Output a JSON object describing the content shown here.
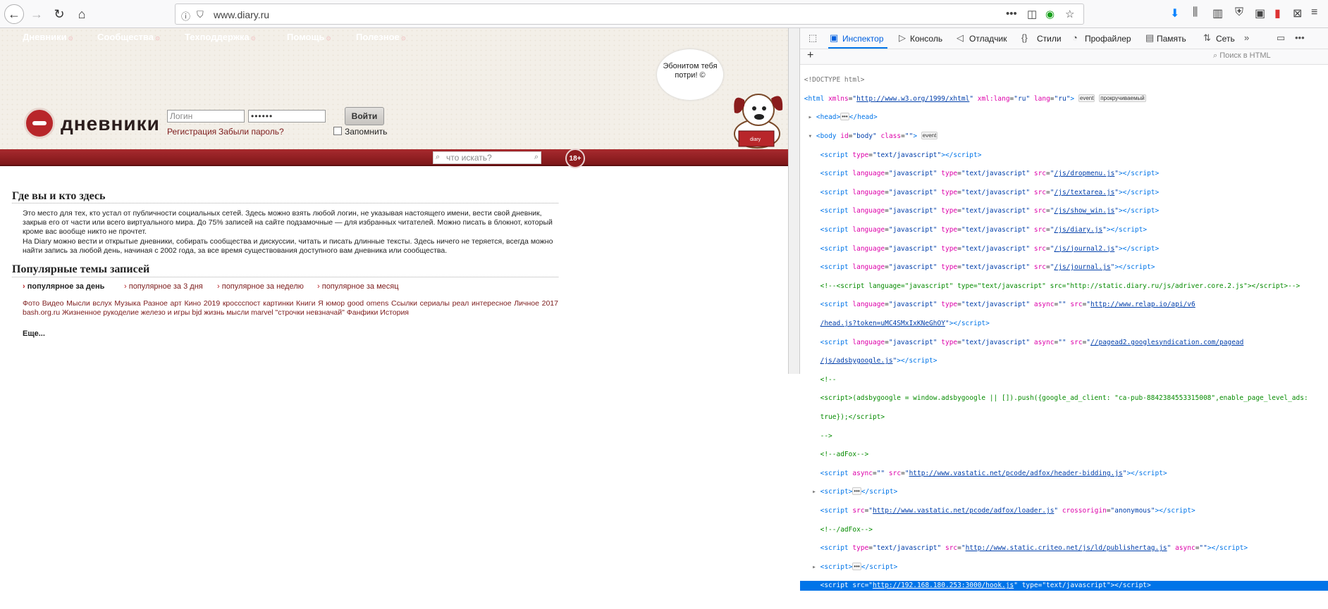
{
  "browser": {
    "url": "www.diary.ru"
  },
  "site": {
    "logo_text": "дневники",
    "bubble_text": "Эбонитом тебя потри! ©",
    "login_placeholder": "Логин",
    "password_value": "••••••",
    "login_button": "Войти",
    "register_link": "Регистрация",
    "forgot_link": "Забыли пароль?",
    "remember_label": "Запомнить",
    "menu": [
      "Дневники",
      "Сообщества",
      "Техподдержка",
      "Помощь",
      "Полезное"
    ],
    "search_placeholder": "что искать?",
    "age_badge": "18+",
    "section1_title": "Где вы и кто здесь",
    "para1": "Это место для тех, кто устал от публичности социальных сетей. Здесь можно взять любой логин, не указывая настоящего имени, вести свой дневник, закрыв его от части или всего виртуального мира. До 75% записей на сайте подзамочные — для избранных читателей. Можно писать в блокнот, который кроме вас вообще никто не прочтет.",
    "para2": "На Diary можно вести и открытые дневники, собирать сообщества и дискуссии, читать и писать длинные тексты. Здесь ничего не теряется, всегда можно найти запись за любой день, начиная с 2002 года, за все время существования доступного вам дневника или сообщества.",
    "section2_title": "Популярные темы записей",
    "tabs": [
      "популярное за день",
      "популярное за 3 дня",
      "популярное за неделю",
      "популярное за месяц"
    ],
    "tags": "Фото Видео Мысли вслух Музыка Разное арт Кино 2019 кроссспост картинки Книги Я юмор good omens Ссылки сериалы реал интересное Личное 2017 bash.org.ru Жизненное рукоделие железо и игры bjd жизнь мысли marvel \"строчки невзначай\" Фанфики История",
    "more_link": "Еще..."
  },
  "devtools": {
    "tabs": [
      "Инспектор",
      "Консоль",
      "Отладчик",
      "Стили",
      "Профайлер",
      "Память",
      "Сеть"
    ],
    "search_placeholder": "Поиск в HTML",
    "badges": {
      "event": "event",
      "scroll": "прокручиваемый",
      "dots": "•••"
    }
  }
}
